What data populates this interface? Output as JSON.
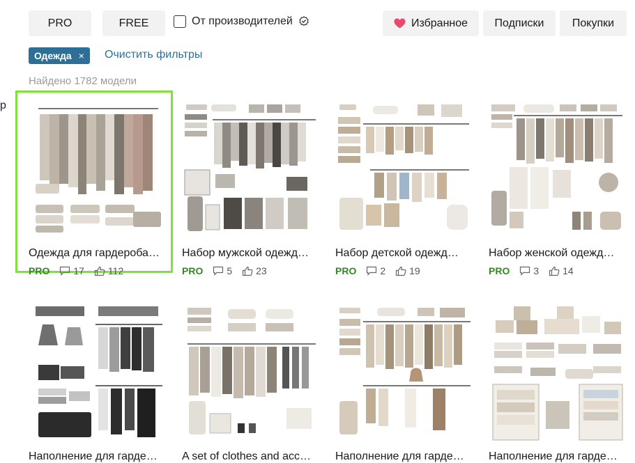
{
  "filters": {
    "pro_label": "PRO",
    "free_label": "FREE",
    "manufacturer_label": "От производителей"
  },
  "header_actions": {
    "favorites_label": "Избранное",
    "subscriptions_label": "Подписки",
    "purchases_label": "Покупки"
  },
  "active_filter": {
    "label": "Одежда",
    "remove": "×"
  },
  "clear_filters_label": "Очистить фильтры",
  "results_count": "Найдено 1782 модели",
  "edge_char": "р",
  "cards": [
    {
      "title": "Одежда для гардероба…",
      "tag": "PRO",
      "comments": "17",
      "likes": "112"
    },
    {
      "title": "Набор мужской одежд…",
      "tag": "PRO",
      "comments": "5",
      "likes": "23"
    },
    {
      "title": "Набор детской одежд…",
      "tag": "PRO",
      "comments": "2",
      "likes": "19"
    },
    {
      "title": "Набор женской одежд…",
      "tag": "PRO",
      "comments": "3",
      "likes": "14"
    },
    {
      "title": "Наполнение для гарде…"
    },
    {
      "title": "A set of clothes and acc…"
    },
    {
      "title": "Наполнение для гарде…"
    },
    {
      "title": "Наполнение для гарде…"
    }
  ],
  "colors": {
    "accent_blue": "#2e6f98",
    "pro_green": "#2e8b1e",
    "selection_green": "#7ee23a",
    "heart": "#e84a6f"
  }
}
